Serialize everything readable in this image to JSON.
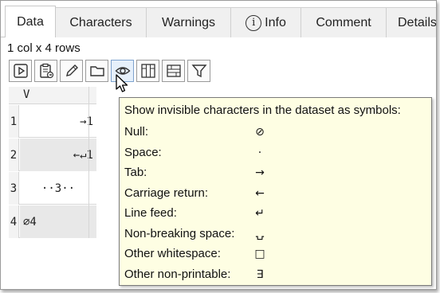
{
  "tabs": [
    {
      "label": "Data",
      "active": true
    },
    {
      "label": "Characters",
      "active": false
    },
    {
      "label": "Warnings",
      "active": false
    },
    {
      "label": "Info",
      "active": false,
      "icon": "info-icon"
    },
    {
      "label": "Comment",
      "active": false
    },
    {
      "label": "Details",
      "active": false
    }
  ],
  "caption": "1 col x 4 rows",
  "toolbar": [
    {
      "icon": "play-icon"
    },
    {
      "icon": "paste-icon"
    },
    {
      "icon": "pencil-icon"
    },
    {
      "icon": "folder-icon"
    },
    {
      "icon": "eye-icon",
      "hovered": true
    },
    {
      "icon": "columns-icon"
    },
    {
      "icon": "rows-icon"
    },
    {
      "icon": "filter-icon"
    }
  ],
  "grid": {
    "column": "V",
    "rows": [
      {
        "num": "1",
        "value": "→1"
      },
      {
        "num": "2",
        "value": "←↵1"
      },
      {
        "num": "3",
        "value": "··3··"
      },
      {
        "num": "4",
        "value": "∅4"
      }
    ]
  },
  "tooltip": {
    "heading": "Show invisible characters in the dataset as symbols:",
    "items": [
      {
        "label": "Null:",
        "symbol": "⊘"
      },
      {
        "label": "Space:",
        "symbol": "·"
      },
      {
        "label": "Tab:",
        "symbol": "→"
      },
      {
        "label": "Carriage return:",
        "symbol": "←"
      },
      {
        "label": "Line feed:",
        "symbol": "↵"
      },
      {
        "label": "Non-breaking space:",
        "symbol": "⍽"
      },
      {
        "label": "Other whitespace:",
        "symbol": "□"
      },
      {
        "label": "Other non-printable:",
        "symbol": "∃"
      }
    ]
  },
  "colors": {
    "tooltip_bg": "#fefee3",
    "alt_row": "#e8e8e8",
    "tab_bg": "#f0f0f0"
  }
}
